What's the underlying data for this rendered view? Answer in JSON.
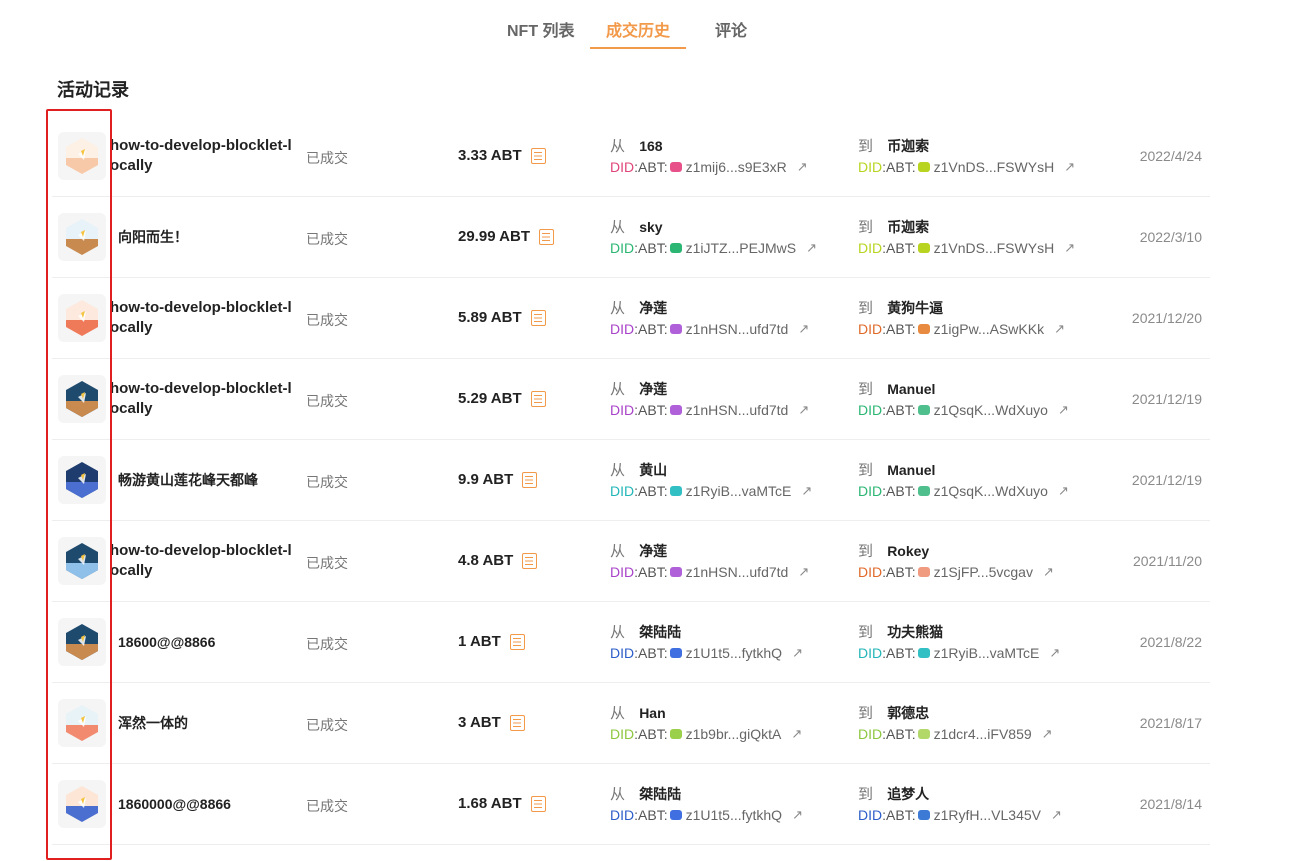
{
  "tabs": [
    {
      "label": "NFT 列表",
      "active": false
    },
    {
      "label": "成交历史",
      "active": true
    },
    {
      "label": "评论",
      "active": false
    }
  ],
  "section_title": "活动记录",
  "rows": [
    {
      "name": "how-to-develop-blocklet-locally",
      "status": "已成交",
      "price": "3.33 ABT",
      "from_dir": "从",
      "from_name": "168",
      "from_did_prefix": "DID",
      "from_abt": ":ABT:",
      "from_addr": "z1mij6...s9E3xR",
      "from_color": "#e0457b",
      "from_swatch": "#e8508a",
      "to_dir": "到",
      "to_name": "币迦索",
      "to_did_prefix": "DID",
      "to_abt": ":ABT:",
      "to_addr": "z1VnDS...FSWYsH",
      "to_color": "#b9d420",
      "to_swatch": "#b9d420",
      "date": "2022/4/24",
      "art": {
        "bg": "#fde3d0",
        "ground": "#f7c9a8",
        "sky": "#fdf0e5"
      }
    },
    {
      "name": "向阳而生！",
      "status": "已成交",
      "price": "29.99 ABT",
      "from_dir": "从",
      "from_name": "sky",
      "from_did_prefix": "DID",
      "from_abt": ":ABT:",
      "from_addr": "z1iJTZ...PEJMwS",
      "from_color": "#2bb673",
      "from_swatch": "#2bb673",
      "to_dir": "到",
      "to_name": "币迦索",
      "to_did_prefix": "DID",
      "to_abt": ":ABT:",
      "to_addr": "z1VnDS...FSWYsH",
      "to_color": "#b9d420",
      "to_swatch": "#b9d420",
      "date": "2022/3/10",
      "art": {
        "bg": "#e7f3f8",
        "ground": "#c98a50",
        "sky": "#e7f3f8"
      }
    },
    {
      "name": "how-to-develop-blocklet-locally",
      "status": "已成交",
      "price": "5.89 ABT",
      "from_dir": "从",
      "from_name": "净莲",
      "from_did_prefix": "DID",
      "from_abt": ":ABT:",
      "from_addr": "z1nHSN...ufd7td",
      "from_color": "#a943c9",
      "from_swatch": "#b060d8",
      "to_dir": "到",
      "to_name": "黄狗牛逼",
      "to_did_prefix": "DID",
      "to_abt": ":ABT:",
      "to_addr": "z1igPw...ASwKKk",
      "to_color": "#e06a2a",
      "to_swatch": "#e88a40",
      "date": "2021/12/20",
      "art": {
        "bg": "#fde1d5",
        "ground": "#ef7a5a",
        "sky": "#fde9dd"
      }
    },
    {
      "name": "how-to-develop-blocklet-locally",
      "status": "已成交",
      "price": "5.29 ABT",
      "from_dir": "从",
      "from_name": "净莲",
      "from_did_prefix": "DID",
      "from_abt": ":ABT:",
      "from_addr": "z1nHSN...ufd7td",
      "from_color": "#a943c9",
      "from_swatch": "#b060d8",
      "to_dir": "到",
      "to_name": "Manuel",
      "to_did_prefix": "DID",
      "to_abt": ":ABT:",
      "to_addr": "z1QsqK...WdXuyo",
      "to_color": "#2bb673",
      "to_swatch": "#4fc08d",
      "date": "2021/12/19",
      "art": {
        "bg": "#1e4a6e",
        "ground": "#c98a50",
        "sky": "#1e4a6e"
      }
    },
    {
      "name": "畅游黄山莲花峰天都峰",
      "status": "已成交",
      "price": "9.9 ABT",
      "from_dir": "从",
      "from_name": "黄山",
      "from_did_prefix": "DID",
      "from_abt": ":ABT:",
      "from_addr": "z1RyiB...vaMTcE",
      "from_color": "#22b6b8",
      "from_swatch": "#33c0c4",
      "to_dir": "到",
      "to_name": "Manuel",
      "to_did_prefix": "DID",
      "to_abt": ":ABT:",
      "to_addr": "z1QsqK...WdXuyo",
      "to_color": "#2bb673",
      "to_swatch": "#4fc08d",
      "date": "2021/12/19",
      "art": {
        "bg": "#1e3c6e",
        "ground": "#4a6fd0",
        "sky": "#1e3c6e"
      }
    },
    {
      "name": "how-to-develop-blocklet-locally",
      "status": "已成交",
      "price": "4.8 ABT",
      "from_dir": "从",
      "from_name": "净莲",
      "from_did_prefix": "DID",
      "from_abt": ":ABT:",
      "from_addr": "z1nHSN...ufd7td",
      "from_color": "#a943c9",
      "from_swatch": "#b060d8",
      "to_dir": "到",
      "to_name": "Rokey",
      "to_did_prefix": "DID",
      "to_abt": ":ABT:",
      "to_addr": "z1SjFP...5vcgav",
      "to_color": "#e06a2a",
      "to_swatch": "#f09a80",
      "date": "2021/11/20",
      "art": {
        "bg": "#1e4a6e",
        "ground": "#8ec0ea",
        "sky": "#1e4a6e"
      }
    },
    {
      "name": "18600@@8866",
      "status": "已成交",
      "price": "1 ABT",
      "from_dir": "从",
      "from_name": "桀陆陆",
      "from_did_prefix": "DID",
      "from_abt": ":ABT:",
      "from_addr": "z1U1t5...fytkhQ",
      "from_color": "#2c5ec9",
      "from_swatch": "#3f6fe0",
      "to_dir": "到",
      "to_name": "功夫熊猫",
      "to_did_prefix": "DID",
      "to_abt": ":ABT:",
      "to_addr": "z1RyiB...vaMTcE",
      "to_color": "#22b6b8",
      "to_swatch": "#33c0c4",
      "date": "2021/8/22",
      "art": {
        "bg": "#1e4a6e",
        "ground": "#c98a50",
        "sky": "#1e4a6e"
      }
    },
    {
      "name": "浑然一体的",
      "status": "已成交",
      "price": "3 ABT",
      "from_dir": "从",
      "from_name": "Han",
      "from_did_prefix": "DID",
      "from_abt": ":ABT:",
      "from_addr": "z1b9br...giQktA",
      "from_color": "#8cc63f",
      "from_swatch": "#9ad04a",
      "to_dir": "到",
      "to_name": "郭德忠",
      "to_did_prefix": "DID",
      "to_abt": ":ABT:",
      "to_addr": "z1dcr4...iFV859",
      "to_color": "#8cc63f",
      "to_swatch": "#b2d86a",
      "date": "2021/8/17",
      "art": {
        "bg": "#e8f3f8",
        "ground": "#f28a70",
        "sky": "#e8f3f8"
      }
    },
    {
      "name": "1860000@@8866",
      "status": "已成交",
      "price": "1.68 ABT",
      "from_dir": "从",
      "from_name": "桀陆陆",
      "from_did_prefix": "DID",
      "from_abt": ":ABT:",
      "from_addr": "z1U1t5...fytkhQ",
      "from_color": "#2c5ec9",
      "from_swatch": "#3f6fe0",
      "to_dir": "到",
      "to_name": "追梦人",
      "to_did_prefix": "DID",
      "to_abt": ":ABT:",
      "to_addr": "z1RyfH...VL345V",
      "to_color": "#2c5ec9",
      "to_swatch": "#3d7ad6",
      "date": "2021/8/14",
      "art": {
        "bg": "#fde6d6",
        "ground": "#4a6fd0",
        "sky": "#fde6d6"
      }
    }
  ]
}
